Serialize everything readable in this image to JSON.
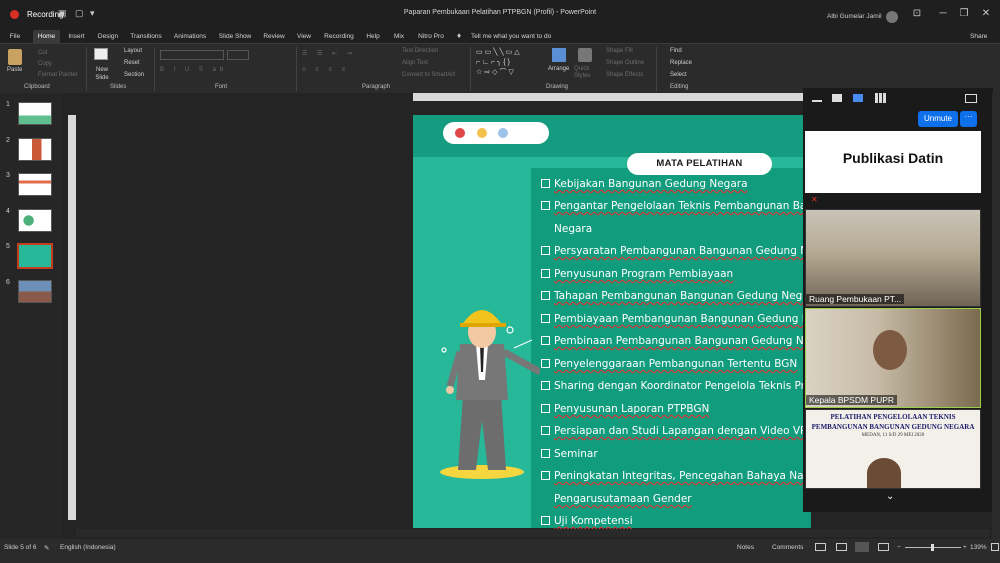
{
  "window": {
    "title": "Paparan Pembukaan Pelatihan PTPBGN (Profil) - PowerPoint",
    "recording_label": "Recording",
    "user_name": "Albi Gumelar Jamil"
  },
  "tabs": [
    "File",
    "Home",
    "Insert",
    "Design",
    "Transitions",
    "Animations",
    "Slide Show",
    "Review",
    "View",
    "Recording",
    "Help",
    "Mix",
    "Nitro Pro"
  ],
  "tell_me": "Tell me what you want to do",
  "share_label": "Share",
  "ribbon": {
    "clipboard": {
      "paste": "Paste",
      "cut": "Cut",
      "copy": "Copy",
      "format_painter": "Format Painter",
      "label": "Clipboard"
    },
    "slides": {
      "new_slide": "New Slide",
      "layout": "Layout",
      "reset": "Reset",
      "section": "Section",
      "label": "Slides"
    },
    "font_label": "Font",
    "paragraph": {
      "text_direction": "Text Direction",
      "align_text": "Align Text",
      "convert": "Convert to SmartArt",
      "label": "Paragraph"
    },
    "drawing": {
      "arrange": "Arrange",
      "quick_styles": "Quick Styles",
      "shape_fill": "Shape Fill",
      "shape_outline": "Shape Outline",
      "shape_effects": "Shape Effects",
      "label": "Drawing"
    },
    "editing": {
      "find": "Find",
      "replace": "Replace",
      "select": "Select",
      "label": "Editing"
    }
  },
  "thumbnails": [
    "1",
    "2",
    "3",
    "4",
    "5",
    "6"
  ],
  "selected_slide": 5,
  "slide": {
    "heading": "MATA PELATIHAN",
    "items": [
      {
        "text": "Kebijakan Bangunan Gedung Negara",
        "checkbox": true
      },
      {
        "text": "Pengantar Pengelolaan Teknis Pembangunan Ban",
        "checkbox": true
      },
      {
        "text": "Negara",
        "checkbox": false
      },
      {
        "text": "Persyaratan Pembangunan Bangunan Gedung Ne",
        "checkbox": true
      },
      {
        "text": "Penyusunan Program Pembiayaan",
        "checkbox": true
      },
      {
        "text": "Tahapan Pembangunan Bangunan Gedung Negar",
        "checkbox": true
      },
      {
        "text": "Pembiayaan Pembangunan Bangunan Gedung N",
        "checkbox": true
      },
      {
        "text": "Pembinaan Pembangunan Bangunan Gedung Ne",
        "checkbox": true
      },
      {
        "text": "Penyelenggaraan Pembangunan Tertentu BGN",
        "checkbox": true
      },
      {
        "text": "Sharing dengan Koordinator Pengelola Teknis Pro",
        "checkbox": true
      },
      {
        "text": "Penyusunan Laporan PTPBGN",
        "checkbox": true
      },
      {
        "text": "Persiapan dan Studi Lapangan dengan Video VR 3",
        "checkbox": true
      },
      {
        "text": "Seminar",
        "checkbox": true
      },
      {
        "text": "Peningkatan Integritas, Pencegahan Bahaya Nark",
        "checkbox": true
      },
      {
        "text": "Pengarusutamaan Gender",
        "checkbox": false
      },
      {
        "text": "Uji Kompetensi",
        "checkbox": true
      }
    ]
  },
  "zoom": {
    "unmute_label": "Unmute",
    "more_label": "···",
    "meeting_name": "Publikasi Datin",
    "participants": [
      {
        "name": "Ruang Pembukaan PT..."
      },
      {
        "name": "Kepala BPSDM PUPR"
      }
    ],
    "banner_line1": "PELATIHAN PENGELOLAAN TEKNIS",
    "banner_line2": "PEMBANGUNAN BANGUNAN GEDUNG NEGARA",
    "banner_line3": "MEDAN, 11 S/D 29 MEI 2020"
  },
  "status": {
    "slide_counter": "Slide 5 of 6",
    "language": "English (Indonesia)",
    "notes": "Notes",
    "comments": "Comments",
    "zoom_level": "139%"
  },
  "colors": {
    "slide_bg": "#26b898",
    "header": "#159b7f",
    "accent_red": "#c43e1c",
    "zoom_blue": "#0e71eb"
  }
}
